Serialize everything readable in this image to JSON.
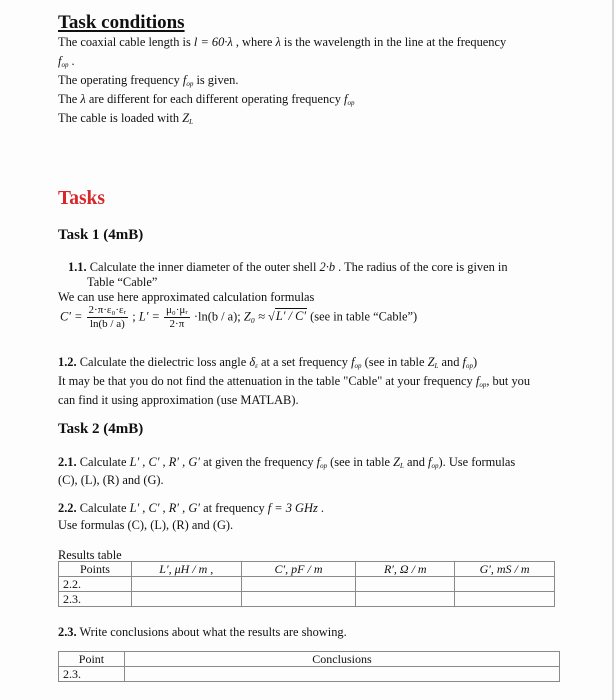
{
  "conditions": {
    "title": "Task conditions",
    "line1_a": "The coaxial cable length is ",
    "line1_formula": "l = 60·λ",
    "line1_b": " , where ",
    "line1_lambda": "λ",
    "line1_c": " is the wavelength in the line at the frequency",
    "line2_f": "f",
    "line2_sub": "op",
    "line2_end": " .",
    "line3_a": "The operating frequency ",
    "line3_f": "f",
    "line3_sub": "op",
    "line3_b": " is given.",
    "line4_a": "The ",
    "line4_lambda": "λ",
    "line4_b": " are different for each different operating frequency ",
    "line4_f": "f",
    "line4_sub": "op",
    "line5_a": "The cable is loaded with ",
    "line5_z": "Z",
    "line5_sub": "L"
  },
  "tasks_heading": "Tasks",
  "task1": {
    "heading": "Task 1 (4mB)",
    "t11_num": "1.1.",
    "t11_text_a": " Calculate the inner diameter of the outer shell ",
    "t11_formula": "2·b",
    "t11_text_b": " . The radius of the core is given in",
    "t11_text_c": "Table “Cable”",
    "formulas_intro": "We can use here approximated calculation formulas",
    "formula_c_lhs": "C′ =",
    "formula_c_num": "2·π·ε₀·εᵣ",
    "formula_c_den": "ln(b / a)",
    "sep1": " ; ",
    "formula_l_lhs": "L′ =",
    "formula_l_num": "μ₀·μᵣ",
    "formula_l_den": "2·π",
    "formula_l_tail": " ·ln(b / a); ",
    "formula_z_lhs": "Z₀ ≈ √",
    "formula_z_rad": "L′ / C′",
    "formula_note": "  (see in table “Cable”)",
    "t12_num": "1.2.",
    "t12_text_a": " Calculate the dielectric loss angle ",
    "t12_delta": "δ",
    "t12_delta_sub": "ε",
    "t12_text_b": " at a set frequency ",
    "t12_f": "f",
    "t12_f_sub": "op",
    "t12_text_c": " (see in table ",
    "t12_z": "Z",
    "t12_z_sub": "L",
    "t12_text_d": " and ",
    "t12_f2": "f",
    "t12_f2_sub": "op",
    "t12_text_e": ")",
    "t12_line2_a": "It may be that you do not find the attenuation in the table \"Cable\" at your frequency ",
    "t12_line2_f": "f",
    "t12_line2_sub": "op",
    "t12_line2_b": ", but you",
    "t12_line3": "can find it using approximation (use MATLAB)."
  },
  "task2": {
    "heading": "Task 2 (4mB)",
    "t21_num": "2.1.",
    "t21_text_a": " Calculate ",
    "t21_vars": "L′ , C′ , R′ , G′",
    "t21_text_b": " at given the frequency ",
    "t21_f": "f",
    "t21_f_sub": "op",
    "t21_text_c": " (see in table ",
    "t21_z": "Z",
    "t21_z_sub": "L",
    "t21_text_d": " and ",
    "t21_f2": "f",
    "t21_f2_sub": "op",
    "t21_text_e": "). Use formulas",
    "t21_line2": "(C), (L), (R) and (G).",
    "t22_num": "2.2.",
    "t22_text_a": " Calculate ",
    "t22_vars": "L′ , C′ , R′ , G′",
    "t22_text_b": "  at frequency ",
    "t22_freq": "f = 3 GHz",
    "t22_text_c": " .",
    "t22_line2": "Use formulas (C), (L), (R) and (G).",
    "results_caption": "Results table",
    "results_headers": [
      "Points",
      "L′, μH / m ,",
      "C′, pF / m",
      "R′, Ω / m",
      "G′, mS / m"
    ],
    "results_rows": [
      {
        "point": "2.2.",
        "cells": [
          "",
          "",
          "",
          ""
        ]
      },
      {
        "point": "2.3.",
        "cells": [
          "",
          "",
          "",
          ""
        ]
      }
    ],
    "t23_num": "2.3.",
    "t23_text": " Write conclusions about what the results are showing.",
    "conclusions_headers": [
      "Point",
      "Conclusions"
    ],
    "conclusions_rows": [
      {
        "point": "2.3.",
        "text": ""
      }
    ]
  },
  "colors": {
    "tasks_heading": "#d9262a",
    "table_border": "#8a8a8a"
  }
}
